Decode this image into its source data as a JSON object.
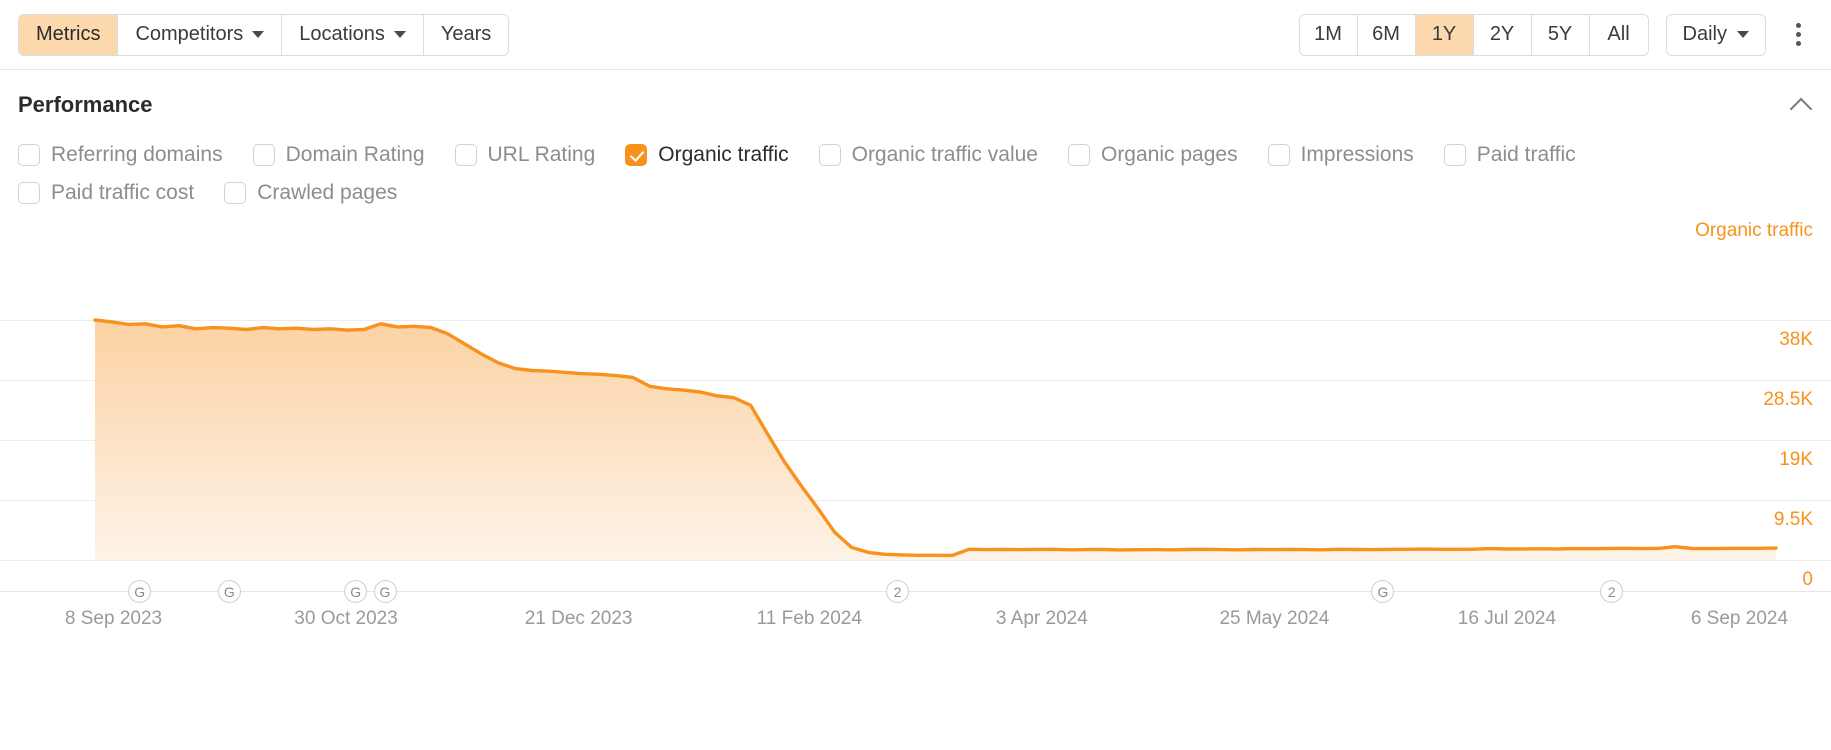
{
  "toolbar": {
    "left_tabs": [
      {
        "label": "Metrics",
        "active": true,
        "dropdown": false
      },
      {
        "label": "Competitors",
        "active": false,
        "dropdown": true
      },
      {
        "label": "Locations",
        "active": false,
        "dropdown": true
      },
      {
        "label": "Years",
        "active": false,
        "dropdown": false
      }
    ],
    "ranges": [
      {
        "label": "1M",
        "active": false
      },
      {
        "label": "6M",
        "active": false
      },
      {
        "label": "1Y",
        "active": true
      },
      {
        "label": "2Y",
        "active": false
      },
      {
        "label": "5Y",
        "active": false
      },
      {
        "label": "All",
        "active": false
      }
    ],
    "granularity": "Daily",
    "more_menu_icon": "kebab-menu-icon"
  },
  "panel": {
    "title": "Performance",
    "collapse_icon": "chevron-up-icon"
  },
  "metrics": [
    [
      {
        "label": "Referring domains",
        "checked": false
      },
      {
        "label": "Domain Rating",
        "checked": false
      },
      {
        "label": "URL Rating",
        "checked": false
      },
      {
        "label": "Organic traffic",
        "checked": true
      },
      {
        "label": "Organic traffic value",
        "checked": false
      },
      {
        "label": "Organic pages",
        "checked": false
      },
      {
        "label": "Impressions",
        "checked": false
      },
      {
        "label": "Paid traffic",
        "checked": false
      }
    ],
    [
      {
        "label": "Paid traffic cost",
        "checked": false
      },
      {
        "label": "Crawled pages",
        "checked": false
      }
    ]
  ],
  "colors": {
    "accent": "#f7921e",
    "accent_fill_top": "#fcd2a3",
    "accent_fill_bottom": "#fdf3e8",
    "active_tab_bg": "#fbd9ac",
    "grid": "#ececec",
    "muted_text": "#8d8d8d"
  },
  "chart_data": {
    "type": "area",
    "title": "Performance",
    "series_label": "Organic traffic",
    "xlabel": "",
    "ylabel": "Organic traffic",
    "grid": true,
    "legend_position": "top-right",
    "ylim": [
      0,
      47500
    ],
    "yticks": [
      "0",
      "9.5K",
      "19K",
      "28.5K",
      "38K"
    ],
    "ytick_values": [
      0,
      9500,
      19000,
      28500,
      38000
    ],
    "xticks": [
      "8 Sep 2023",
      "30 Oct 2023",
      "21 Dec 2023",
      "11 Feb 2024",
      "3 Apr 2024",
      "25 May 2024",
      "16 Jul 2024",
      "6 Sep 2024"
    ],
    "xtick_positions_pct": [
      6.2,
      18.9,
      31.6,
      44.2,
      56.9,
      69.6,
      82.3,
      95.0
    ],
    "annotations": [
      {
        "label": "G",
        "x_pct": 7.6,
        "type": "google-update"
      },
      {
        "label": "G",
        "x_pct": 12.5,
        "type": "google-update"
      },
      {
        "label": "G",
        "x_pct": 19.4,
        "type": "google-update"
      },
      {
        "label": "G",
        "x_pct": 21.0,
        "type": "google-update"
      },
      {
        "label": "2",
        "x_pct": 49.0,
        "type": "annotation-cluster"
      },
      {
        "label": "G",
        "x_pct": 75.5,
        "type": "google-update"
      },
      {
        "label": "2",
        "x_pct": 88.0,
        "type": "annotation-cluster"
      }
    ],
    "x": [
      0,
      1,
      2,
      3,
      4,
      5,
      6,
      7,
      8,
      9,
      10,
      11,
      12,
      13,
      14,
      15,
      16,
      17,
      18,
      19,
      20,
      21,
      22,
      23,
      24,
      25,
      26,
      27,
      28,
      29,
      30,
      31,
      32,
      33,
      34,
      35,
      36,
      37,
      38,
      39,
      40,
      41,
      42,
      43,
      44,
      45,
      46,
      47,
      48,
      49,
      50,
      51,
      52,
      53,
      54,
      55,
      56,
      57,
      58,
      59,
      60,
      61,
      62,
      63,
      64,
      65,
      66,
      67,
      68,
      69,
      70,
      71,
      72,
      73,
      74,
      75,
      76,
      77,
      78,
      79,
      80,
      81,
      82,
      83,
      84,
      85,
      86,
      87,
      88,
      89,
      90,
      91,
      92,
      93,
      94,
      95,
      96,
      97,
      98,
      99,
      100
    ],
    "values": [
      38000,
      37700,
      37300,
      37400,
      36900,
      37100,
      36600,
      36800,
      36700,
      36500,
      36800,
      36600,
      36700,
      36500,
      36600,
      36400,
      36500,
      37400,
      36900,
      37000,
      36800,
      35800,
      34200,
      32600,
      31200,
      30300,
      30000,
      29900,
      29700,
      29500,
      29400,
      29200,
      28900,
      27500,
      27100,
      26900,
      26600,
      26000,
      25700,
      24500,
      20000,
      15600,
      11800,
      8200,
      4400,
      2000,
      1200,
      900,
      800,
      750,
      740,
      730,
      1700,
      1650,
      1660,
      1640,
      1680,
      1700,
      1620,
      1640,
      1660,
      1600,
      1630,
      1650,
      1620,
      1660,
      1700,
      1640,
      1620,
      1660,
      1640,
      1680,
      1650,
      1620,
      1700,
      1660,
      1640,
      1680,
      1700,
      1720,
      1700,
      1690,
      1710,
      1800,
      1740,
      1760,
      1780,
      1750,
      1800,
      1790,
      1820,
      1850,
      1800,
      1830,
      2100,
      1820,
      1800,
      1830,
      1850,
      1860,
      1880
    ]
  }
}
